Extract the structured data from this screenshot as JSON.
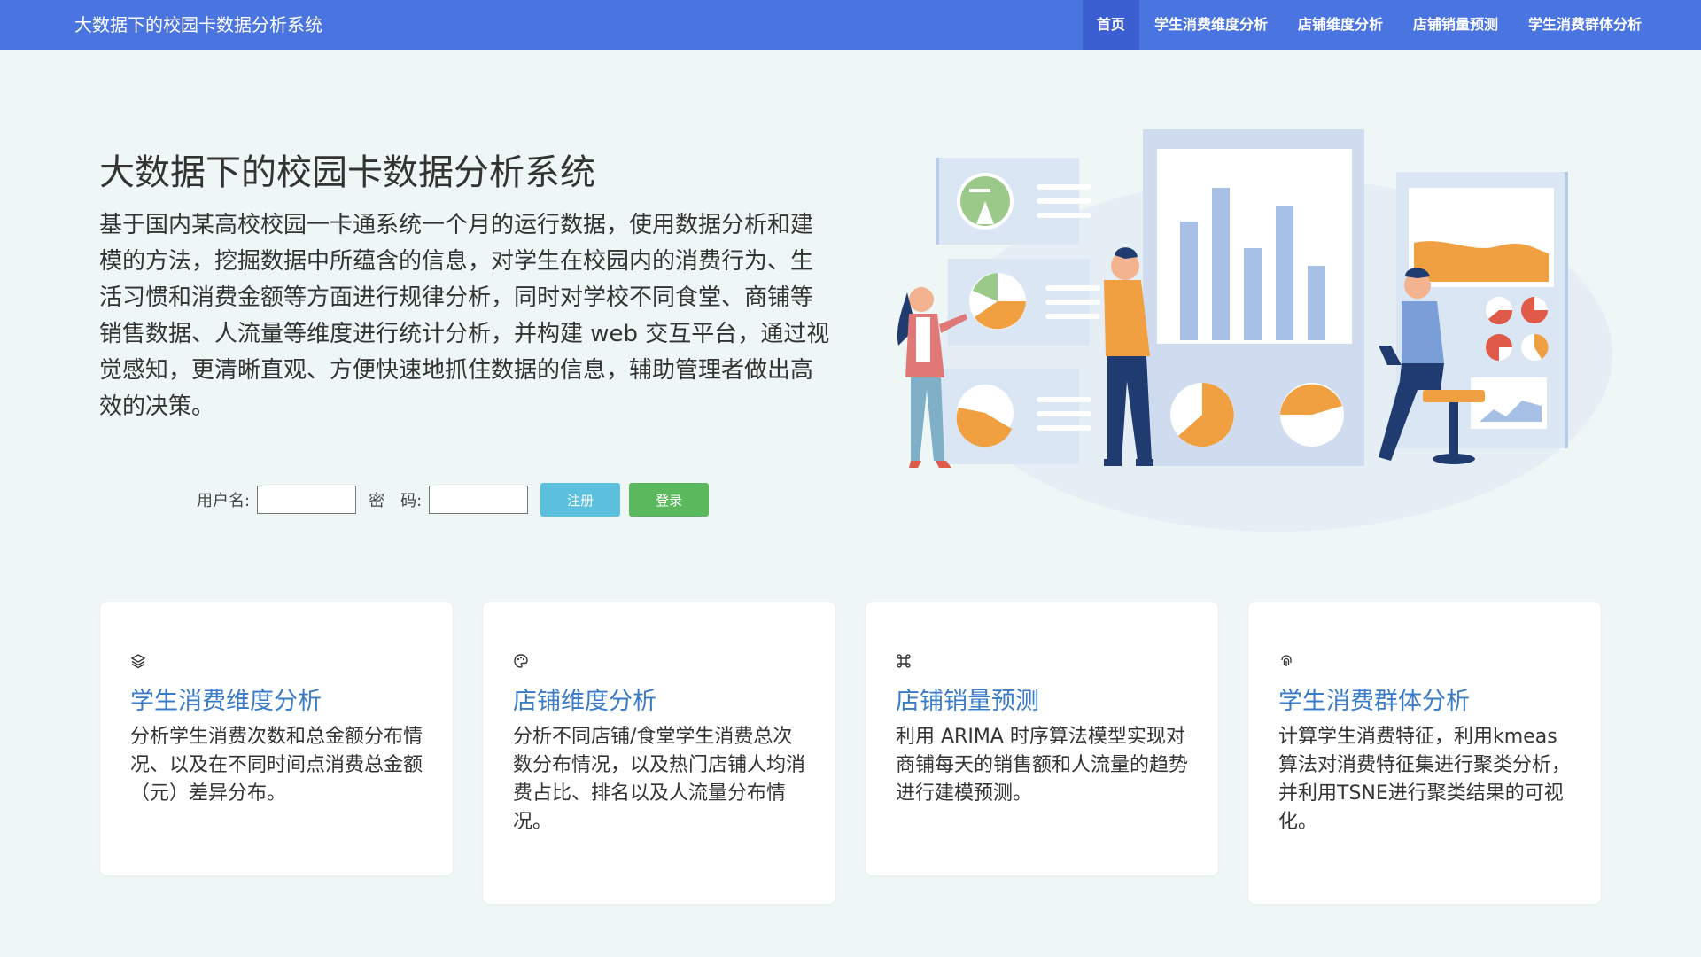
{
  "navbar": {
    "brand": "大数据下的校园卡数据分析系统",
    "items": [
      {
        "label": "首页"
      },
      {
        "label": "学生消费维度分析"
      },
      {
        "label": "店铺维度分析"
      },
      {
        "label": "店铺销量预测"
      },
      {
        "label": "学生消费群体分析"
      }
    ]
  },
  "hero": {
    "title": "大数据下的校园卡数据分析系统",
    "description": "基于国内某高校校园一卡通系统一个月的运行数据，使用数据分析和建模的方法，挖掘数据中所蕴含的信息，对学生在校园内的消费行为、生活习惯和消费金额等方面进行规律分析，同时对学校不同食堂、商铺等销售数据、人流量等维度进行统计分析，并构建 web 交互平台，通过视觉感知，更清晰直观、方便快速地抓住数据的信息，辅助管理者做出高效的决策。"
  },
  "login": {
    "username_label": "用户名:",
    "password_label": "密　码:",
    "username_value": "",
    "password_value": "",
    "register_label": "注册",
    "login_label": "登录"
  },
  "cards": [
    {
      "icon": "layers-icon",
      "title": "学生消费维度分析",
      "text": "分析学生消费次数和总金额分布情况、以及在不同时间点消费总金额（元）差异分布。"
    },
    {
      "icon": "palette-icon",
      "title": "店铺维度分析",
      "text": "分析不同店铺/食堂学生消费总次数分布情况，以及热门店铺人均消费占比、排名以及人流量分布情况。"
    },
    {
      "icon": "command-icon",
      "title": "店铺销量预测",
      "text": "利用 ARIMA 时序算法模型实现对商铺每天的销售额和人流量的趋势进行建模预测。"
    },
    {
      "icon": "fingerprint-icon",
      "title": "学生消费群体分析",
      "text": "计算学生消费特征，利用kmeas算法对消费特征集进行聚类分析，并利用TSNE进行聚类结果的可视化。"
    }
  ],
  "colors": {
    "navbar": "#4a74e0",
    "navbar_active": "#3b5fd0",
    "background": "#eef6f6",
    "card_title": "#3a7bc8",
    "register_button": "#5bc0de",
    "login_button": "#5cb85c"
  }
}
